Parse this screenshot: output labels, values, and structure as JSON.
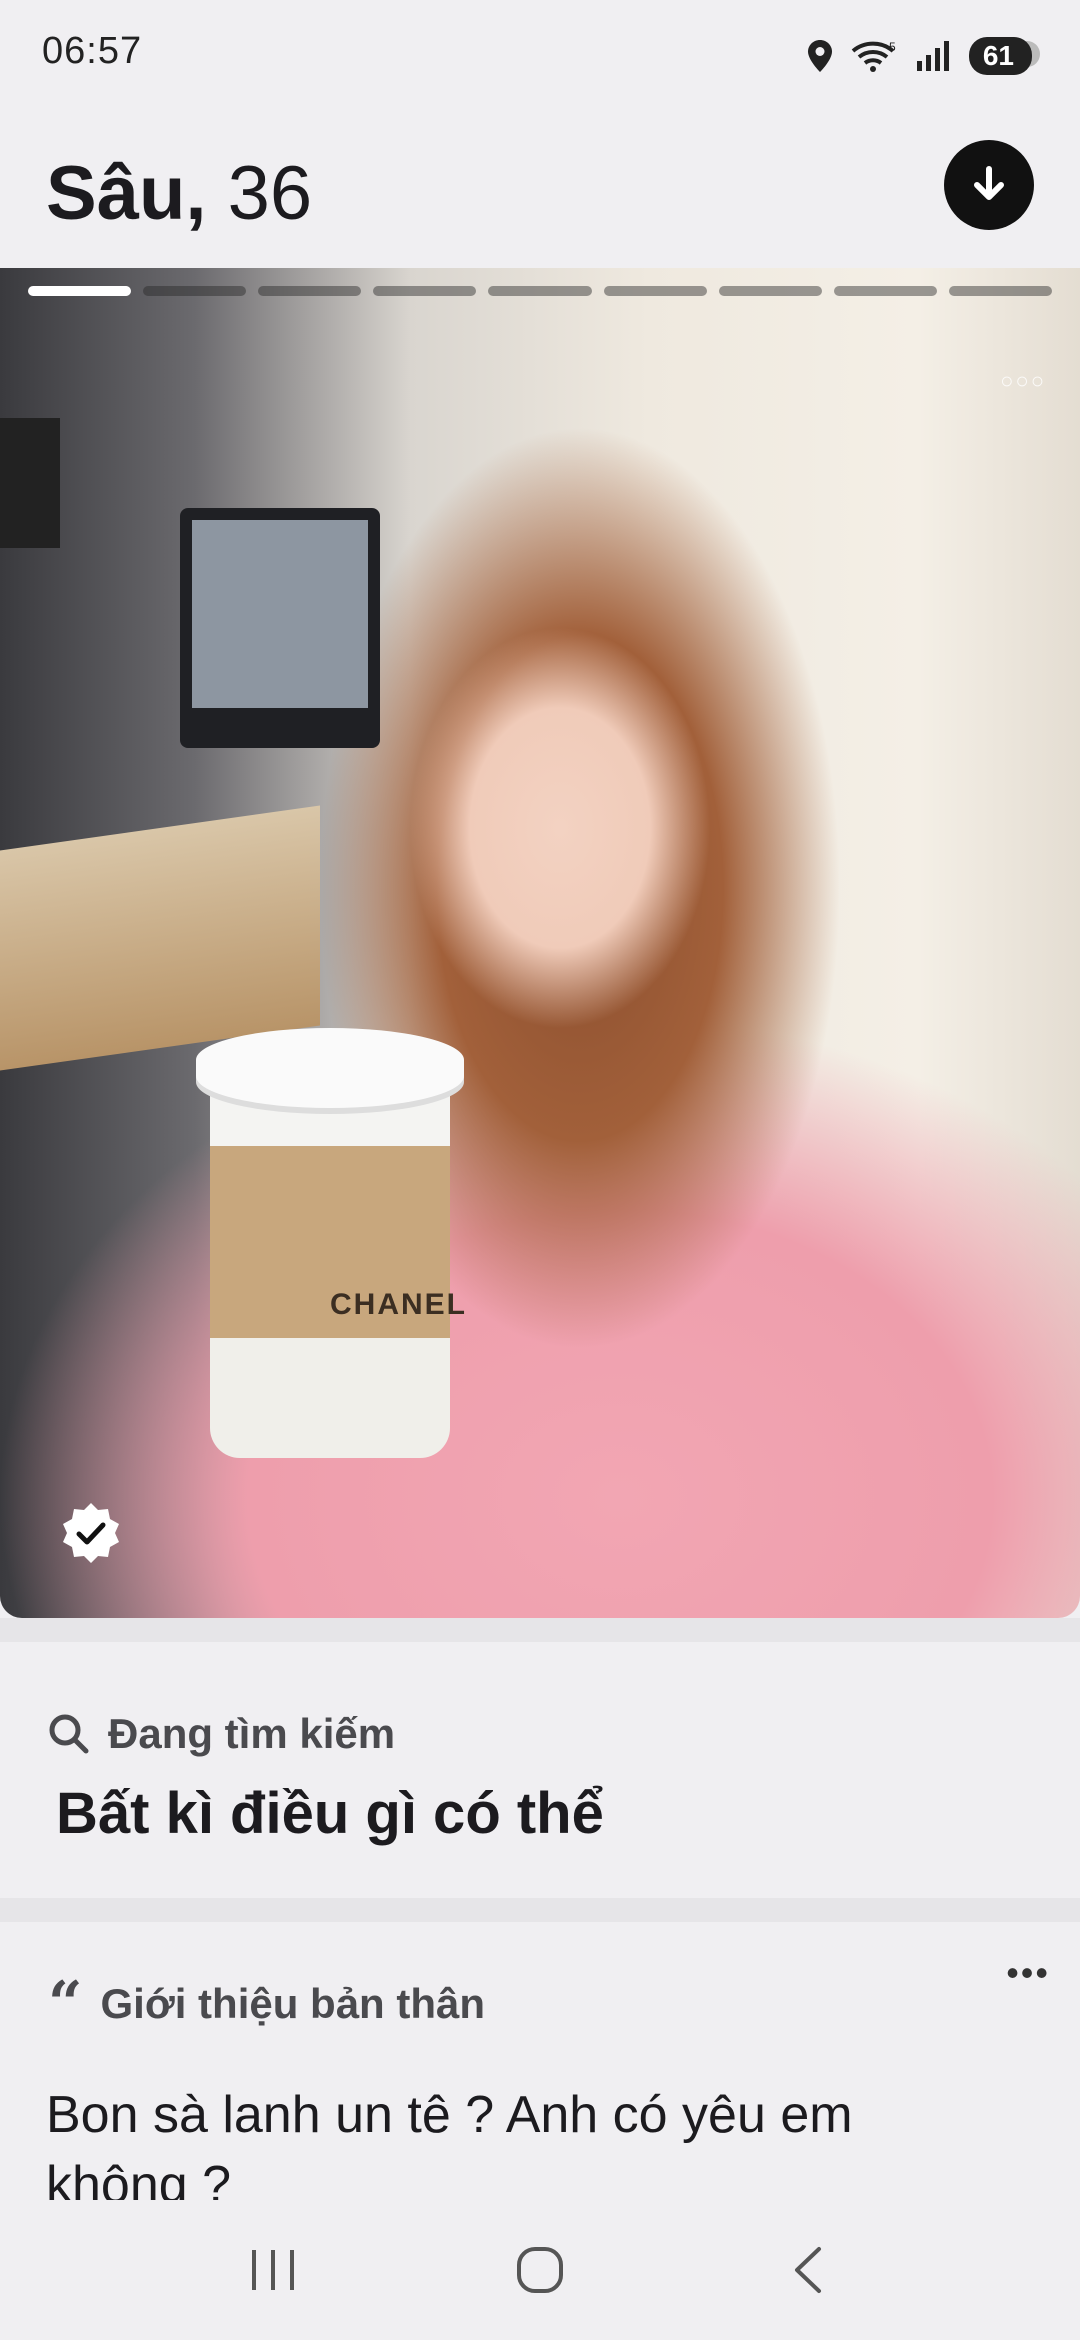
{
  "status_bar": {
    "time": "06:57",
    "battery": "61",
    "icons": [
      "location-icon",
      "wifi-icon",
      "signal-icon",
      "battery-icon"
    ]
  },
  "profile": {
    "name": "Sâu,",
    "age": "36"
  },
  "photo": {
    "total_photos": 9,
    "active_index": 0,
    "cup_brand": "CHANEL"
  },
  "looking_for": {
    "label": "Đang tìm kiếm",
    "value": "Bất kì điều gì có thể"
  },
  "about": {
    "label": "Giới thiệu bản thân",
    "text": "Bon sà lanh un tê ? Anh có yêu em không ?"
  },
  "colors": {
    "accent": "#111111",
    "background": "#f0eff2"
  }
}
